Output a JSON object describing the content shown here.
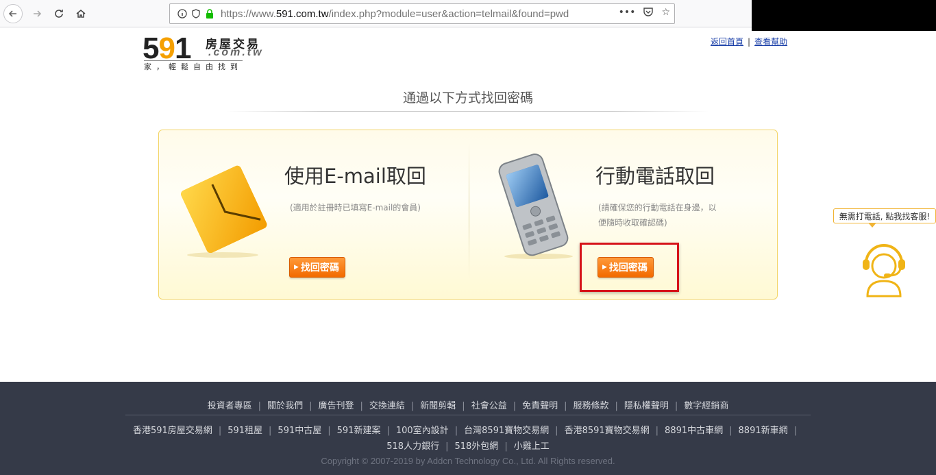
{
  "browser": {
    "url_prefix": "https://www.",
    "url_domain": "591.com.tw",
    "url_path": "/index.php?module=user&action=telmail&found=pwd"
  },
  "header": {
    "logo_number": "591",
    "logo_cn": "房屋交易",
    "logo_domain": ".com.tw",
    "logo_slogan": "家，輕鬆自由找到",
    "link_home": "返回首頁",
    "link_help": "查看幫助"
  },
  "main": {
    "title": "通過以下方式找回密碼",
    "email_option": {
      "title": "使用E-mail取回",
      "desc": "(適用於註冊時已填寫E-mail的會員)",
      "button": "找回密碼"
    },
    "phone_option": {
      "title": "行動電話取回",
      "desc_line1": "(請確保您的行動電話在身邊，以",
      "desc_line2": "便隨時收取確認碼)",
      "button": "找回密碼"
    }
  },
  "chat": {
    "bubble": "無需打電話, 點我找客服!"
  },
  "footer": {
    "links_row1": [
      "投資者專區",
      "關於我們",
      "廣告刊登",
      "交換連結",
      "新聞剪輯",
      "社會公益",
      "免責聲明",
      "服務條款",
      "隱私權聲明",
      "數字經銷商"
    ],
    "links_row2": [
      "香港591房屋交易網",
      "591租屋",
      "591中古屋",
      "591新建案",
      "100室內設計",
      "台灣8591寶物交易網",
      "香港8591寶物交易網",
      "8891中古車網",
      "8891新車網"
    ],
    "links_row3": [
      "518人力銀行",
      "518外包網",
      "小雞上工"
    ],
    "copyright": "Copyright © 2007-2019 by Addcn Technology Co., Ltd. All Rights reserved."
  },
  "colors": {
    "accent_orange": "#f26a00",
    "highlight_red": "#d6141a",
    "footer_bg": "#353a48",
    "link_blue": "#1a3fa8"
  }
}
